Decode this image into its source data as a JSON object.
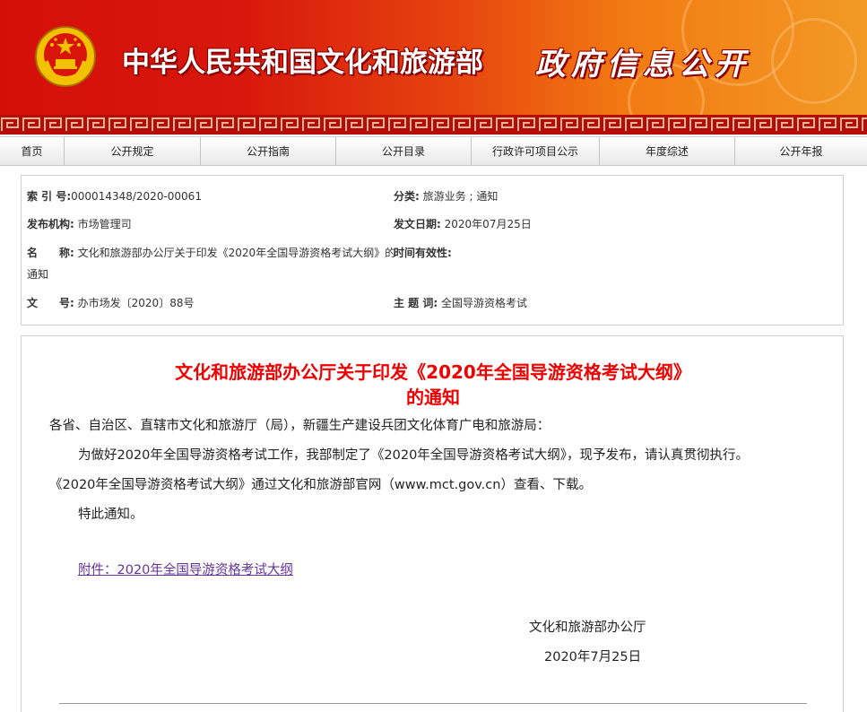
{
  "header": {
    "ministry_name": "中华人民共和国文化和旅游部",
    "section_title": "政府信息公开"
  },
  "nav": {
    "items": [
      "首页",
      "公开规定",
      "公开指南",
      "公开目录",
      "行政许可项目公示",
      "年度综述",
      "公开年报"
    ]
  },
  "meta": {
    "index_label": "索 引 号:",
    "index_value": "000014348/2020-00061",
    "category_label": "分类:",
    "category_value": "旅游业务 ; 通知",
    "issuer_label": "发布机构:",
    "issuer_value": "市场管理司",
    "date_label": "发文日期:",
    "date_value": "2020年07月25日",
    "name_label_1": "名",
    "name_label_2": "称:",
    "name_value_1": "文化和旅游部办公厅关于印发《2020年全国导游资格考试大纲》的",
    "name_value_2": "通知",
    "validity_label": "时间有效性:",
    "doc_label_1": "文",
    "doc_label_2": "号:",
    "doc_value": "办市场发〔2020〕88号",
    "topic_label": "主 题 词:",
    "topic_value": "全国导游资格考试"
  },
  "article": {
    "title_line1": "文化和旅游部办公厅关于印发《2020年全国导游资格考试大纲》",
    "title_line2": "的通知",
    "addressee": "各省、自治区、直辖市文化和旅游厅（局），新疆生产建设兵团文化体育广电和旅游局：",
    "body_line1": "为做好2020年全国导游资格考试工作，我部制定了《2020年全国导游资格考试大纲》，现予发布，请认真贯彻执行。",
    "body_line2": "《2020年全国导游资格考试大纲》通过文化和旅游部官网（www.mct.gov.cn）查看、下载。",
    "closing": "特此通知。",
    "attachment": "附件：2020年全国导游资格考试大纲",
    "signature": "文化和旅游部办公厅",
    "sign_date": "2020年7月25日"
  },
  "colors": {
    "banner_red": "#d40f08",
    "banner_orange": "#f29a26",
    "title_red": "#ee0000",
    "link_purple": "#663399"
  }
}
